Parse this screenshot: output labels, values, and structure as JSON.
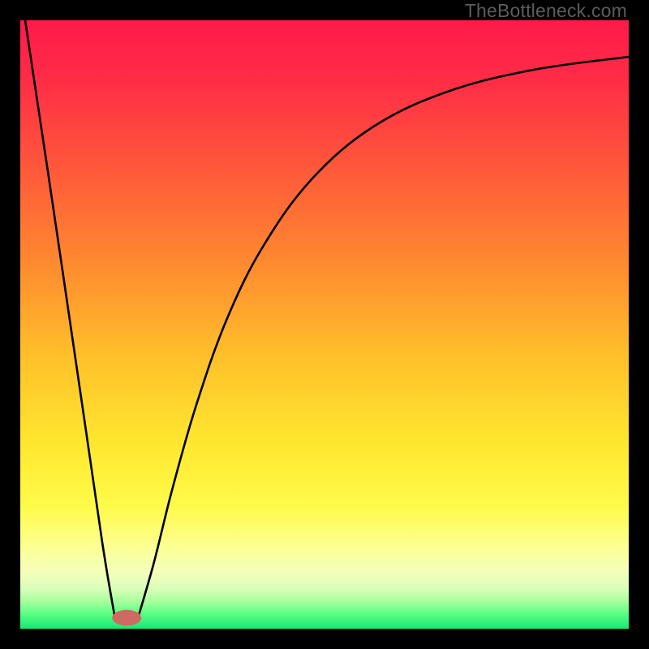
{
  "watermark": "TheBottleneck.com",
  "gradient": {
    "stops": [
      {
        "offset": 0.0,
        "color": "#ff1a4b"
      },
      {
        "offset": 0.1,
        "color": "#ff2d46"
      },
      {
        "offset": 0.25,
        "color": "#ff5a3a"
      },
      {
        "offset": 0.4,
        "color": "#ff8a2f"
      },
      {
        "offset": 0.55,
        "color": "#ffbf2a"
      },
      {
        "offset": 0.7,
        "color": "#ffe82f"
      },
      {
        "offset": 0.8,
        "color": "#fffb4a"
      },
      {
        "offset": 0.86,
        "color": "#fdff8c"
      },
      {
        "offset": 0.905,
        "color": "#f5ffba"
      },
      {
        "offset": 0.935,
        "color": "#d8ffb8"
      },
      {
        "offset": 0.955,
        "color": "#a7ff9e"
      },
      {
        "offset": 0.975,
        "color": "#5cff84"
      },
      {
        "offset": 1.0,
        "color": "#17e873"
      }
    ]
  },
  "chart_data": {
    "type": "line",
    "title": "",
    "xlabel": "",
    "ylabel": "",
    "xlim": [
      0,
      100
    ],
    "ylim": [
      0,
      100
    ],
    "series": [
      {
        "name": "left-branch",
        "x": [
          0.8,
          5,
          10,
          13.5,
          15.5
        ],
        "y": [
          100,
          72,
          38,
          14,
          2.1
        ]
      },
      {
        "name": "right-branch",
        "x": [
          19.5,
          22,
          25,
          29,
          34,
          40,
          48,
          58,
          70,
          84,
          100
        ],
        "y": [
          2.3,
          11,
          23,
          37,
          51,
          63,
          74,
          82.5,
          88.2,
          91.8,
          94.0
        ]
      }
    ],
    "marker": {
      "name": "bottleneck-point",
      "x": 17.5,
      "y": 1.8,
      "rx": 2.4,
      "ry": 1.3,
      "color": "#cf6a63"
    }
  }
}
